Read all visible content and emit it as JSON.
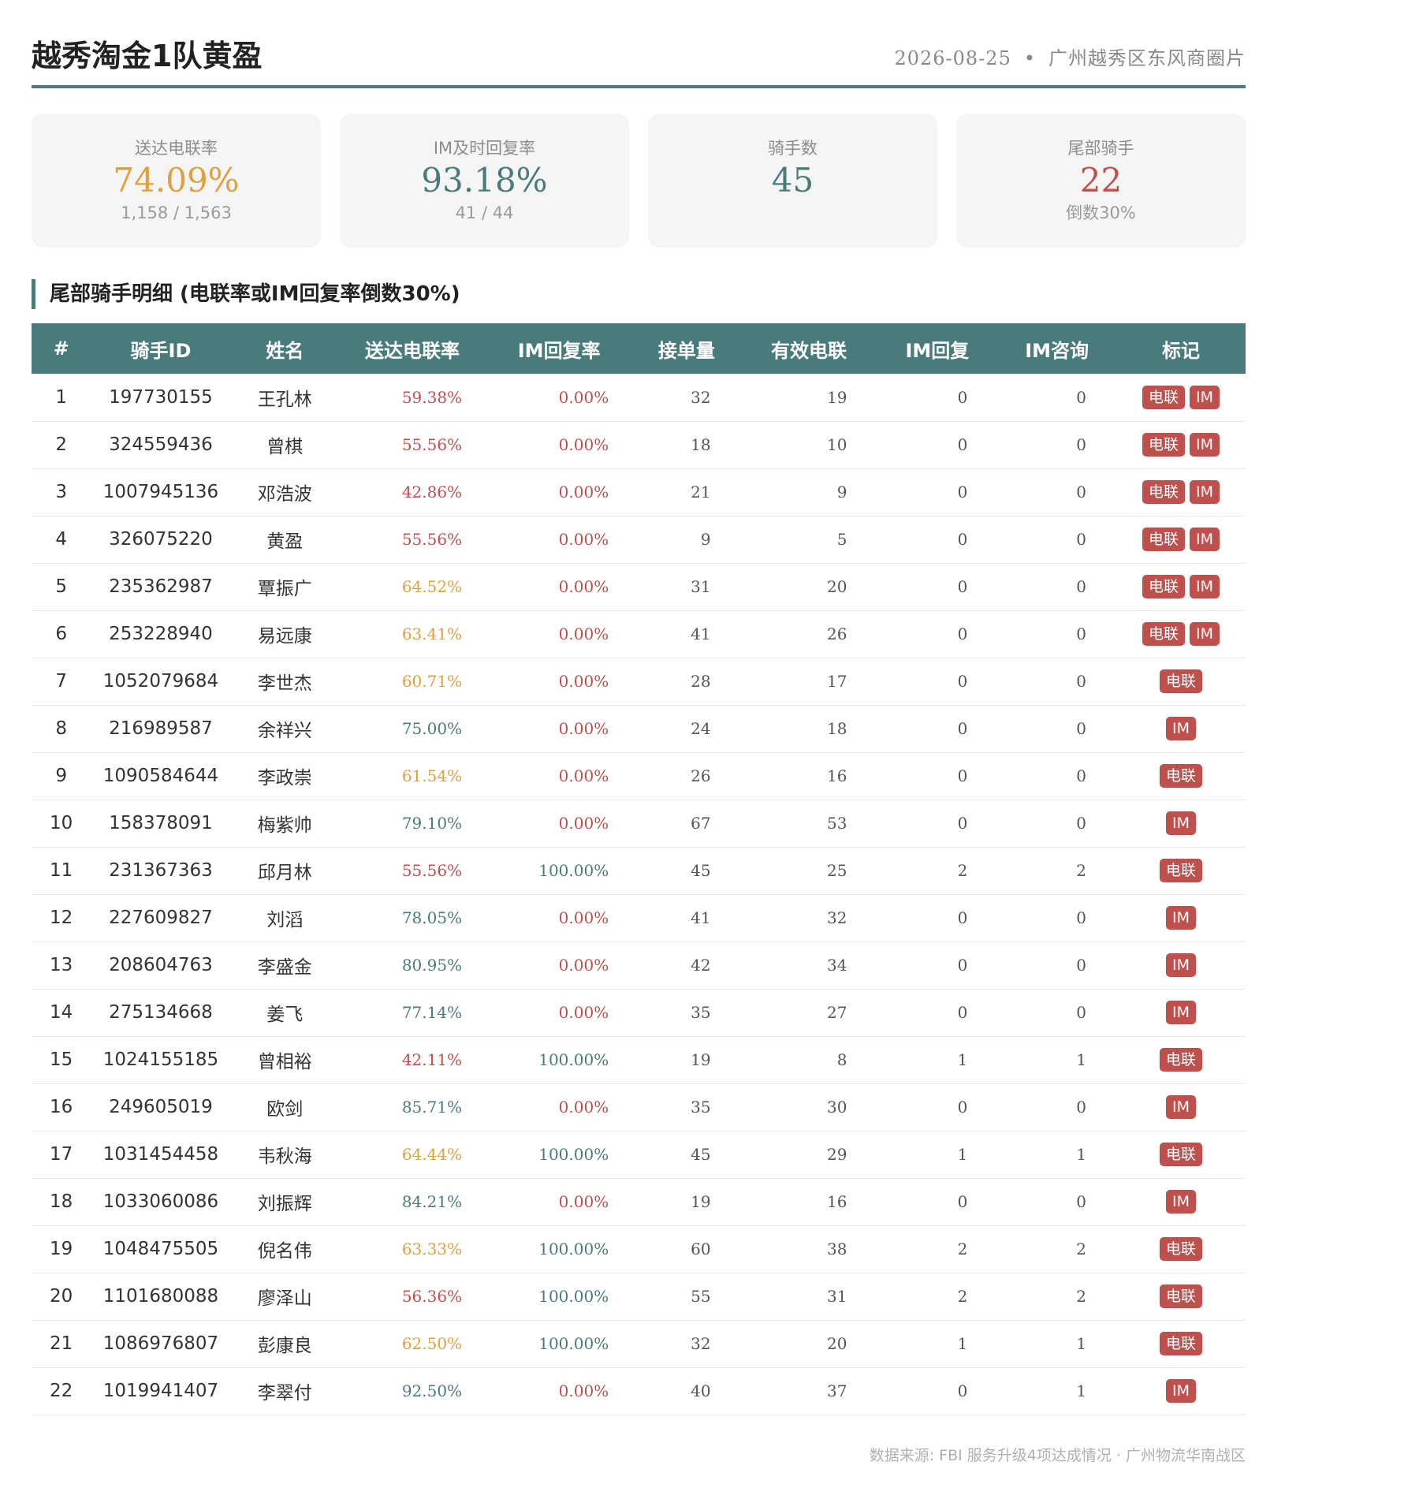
{
  "header": {
    "title": "越秀淘金1队黄盈",
    "date": "2026-08-25",
    "separator": "•",
    "area": "广州越秀区东风商圈片"
  },
  "cards": [
    {
      "label": "送达电联率",
      "value": "74.09%",
      "sub": "1,158 / 1,563"
    },
    {
      "label": "IM及时回复率",
      "value": "93.18%",
      "sub": "41 / 44"
    },
    {
      "label": "骑手数",
      "value": "45",
      "sub": ""
    },
    {
      "label": "尾部骑手",
      "value": "22",
      "sub": "倒数30%"
    }
  ],
  "section_title": "尾部骑手明细 (电联率或IM回复率倒数30%)",
  "table": {
    "columns": [
      "#",
      "骑手ID",
      "姓名",
      "送达电联率",
      "IM回复率",
      "接单量",
      "有效电联",
      "IM回复",
      "IM咨询",
      "标记"
    ],
    "rows": [
      {
        "idx": "1",
        "id": "197730155",
        "name": "王孔林",
        "call_rate": "59.38%",
        "im_rate": "0.00%",
        "orders": "32",
        "calls": "19",
        "im_reply": "0",
        "im_consult": "0",
        "tags": [
          "电联",
          "IM"
        ]
      },
      {
        "idx": "2",
        "id": "324559436",
        "name": "曾棋",
        "call_rate": "55.56%",
        "im_rate": "0.00%",
        "orders": "18",
        "calls": "10",
        "im_reply": "0",
        "im_consult": "0",
        "tags": [
          "电联",
          "IM"
        ]
      },
      {
        "idx": "3",
        "id": "1007945136",
        "name": "邓浩波",
        "call_rate": "42.86%",
        "im_rate": "0.00%",
        "orders": "21",
        "calls": "9",
        "im_reply": "0",
        "im_consult": "0",
        "tags": [
          "电联",
          "IM"
        ]
      },
      {
        "idx": "4",
        "id": "326075220",
        "name": "黄盈",
        "call_rate": "55.56%",
        "im_rate": "0.00%",
        "orders": "9",
        "calls": "5",
        "im_reply": "0",
        "im_consult": "0",
        "tags": [
          "电联",
          "IM"
        ]
      },
      {
        "idx": "5",
        "id": "235362987",
        "name": "覃振广",
        "call_rate": "64.52%",
        "im_rate": "0.00%",
        "orders": "31",
        "calls": "20",
        "im_reply": "0",
        "im_consult": "0",
        "tags": [
          "电联",
          "IM"
        ]
      },
      {
        "idx": "6",
        "id": "253228940",
        "name": "易远康",
        "call_rate": "63.41%",
        "im_rate": "0.00%",
        "orders": "41",
        "calls": "26",
        "im_reply": "0",
        "im_consult": "0",
        "tags": [
          "电联",
          "IM"
        ]
      },
      {
        "idx": "7",
        "id": "1052079684",
        "name": "李世杰",
        "call_rate": "60.71%",
        "im_rate": "0.00%",
        "orders": "28",
        "calls": "17",
        "im_reply": "0",
        "im_consult": "0",
        "tags": [
          "电联"
        ]
      },
      {
        "idx": "8",
        "id": "216989587",
        "name": "余祥兴",
        "call_rate": "75.00%",
        "im_rate": "0.00%",
        "orders": "24",
        "calls": "18",
        "im_reply": "0",
        "im_consult": "0",
        "tags": [
          "IM"
        ]
      },
      {
        "idx": "9",
        "id": "1090584644",
        "name": "李政崇",
        "call_rate": "61.54%",
        "im_rate": "0.00%",
        "orders": "26",
        "calls": "16",
        "im_reply": "0",
        "im_consult": "0",
        "tags": [
          "电联"
        ]
      },
      {
        "idx": "10",
        "id": "158378091",
        "name": "梅紫帅",
        "call_rate": "79.10%",
        "im_rate": "0.00%",
        "orders": "67",
        "calls": "53",
        "im_reply": "0",
        "im_consult": "0",
        "tags": [
          "IM"
        ]
      },
      {
        "idx": "11",
        "id": "231367363",
        "name": "邱月林",
        "call_rate": "55.56%",
        "im_rate": "100.00%",
        "orders": "45",
        "calls": "25",
        "im_reply": "2",
        "im_consult": "2",
        "tags": [
          "电联"
        ]
      },
      {
        "idx": "12",
        "id": "227609827",
        "name": "刘滔",
        "call_rate": "78.05%",
        "im_rate": "0.00%",
        "orders": "41",
        "calls": "32",
        "im_reply": "0",
        "im_consult": "0",
        "tags": [
          "IM"
        ]
      },
      {
        "idx": "13",
        "id": "208604763",
        "name": "李盛金",
        "call_rate": "80.95%",
        "im_rate": "0.00%",
        "orders": "42",
        "calls": "34",
        "im_reply": "0",
        "im_consult": "0",
        "tags": [
          "IM"
        ]
      },
      {
        "idx": "14",
        "id": "275134668",
        "name": "姜飞",
        "call_rate": "77.14%",
        "im_rate": "0.00%",
        "orders": "35",
        "calls": "27",
        "im_reply": "0",
        "im_consult": "0",
        "tags": [
          "IM"
        ]
      },
      {
        "idx": "15",
        "id": "1024155185",
        "name": "曾相裕",
        "call_rate": "42.11%",
        "im_rate": "100.00%",
        "orders": "19",
        "calls": "8",
        "im_reply": "1",
        "im_consult": "1",
        "tags": [
          "电联"
        ]
      },
      {
        "idx": "16",
        "id": "249605019",
        "name": "欧剑",
        "call_rate": "85.71%",
        "im_rate": "0.00%",
        "orders": "35",
        "calls": "30",
        "im_reply": "0",
        "im_consult": "0",
        "tags": [
          "IM"
        ]
      },
      {
        "idx": "17",
        "id": "1031454458",
        "name": "韦秋海",
        "call_rate": "64.44%",
        "im_rate": "100.00%",
        "orders": "45",
        "calls": "29",
        "im_reply": "1",
        "im_consult": "1",
        "tags": [
          "电联"
        ]
      },
      {
        "idx": "18",
        "id": "1033060086",
        "name": "刘振辉",
        "call_rate": "84.21%",
        "im_rate": "0.00%",
        "orders": "19",
        "calls": "16",
        "im_reply": "0",
        "im_consult": "0",
        "tags": [
          "IM"
        ]
      },
      {
        "idx": "19",
        "id": "1048475505",
        "name": "倪名伟",
        "call_rate": "63.33%",
        "im_rate": "100.00%",
        "orders": "60",
        "calls": "38",
        "im_reply": "2",
        "im_consult": "2",
        "tags": [
          "电联"
        ]
      },
      {
        "idx": "20",
        "id": "1101680088",
        "name": "廖泽山",
        "call_rate": "56.36%",
        "im_rate": "100.00%",
        "orders": "55",
        "calls": "31",
        "im_reply": "2",
        "im_consult": "2",
        "tags": [
          "电联"
        ]
      },
      {
        "idx": "21",
        "id": "1086976807",
        "name": "彭康良",
        "call_rate": "62.50%",
        "im_rate": "100.00%",
        "orders": "32",
        "calls": "20",
        "im_reply": "1",
        "im_consult": "1",
        "tags": [
          "电联"
        ]
      },
      {
        "idx": "22",
        "id": "1019941407",
        "name": "李翠付",
        "call_rate": "92.50%",
        "im_rate": "0.00%",
        "orders": "40",
        "calls": "37",
        "im_reply": "0",
        "im_consult": "1",
        "tags": [
          "IM"
        ]
      }
    ]
  },
  "footer": "数据来源: FBI 服务升级4项达成情况 · 广州物流华南战区",
  "colors": {
    "accent": "#4a7b7c",
    "warning": "#e0a03c",
    "danger": "#c0504d"
  }
}
